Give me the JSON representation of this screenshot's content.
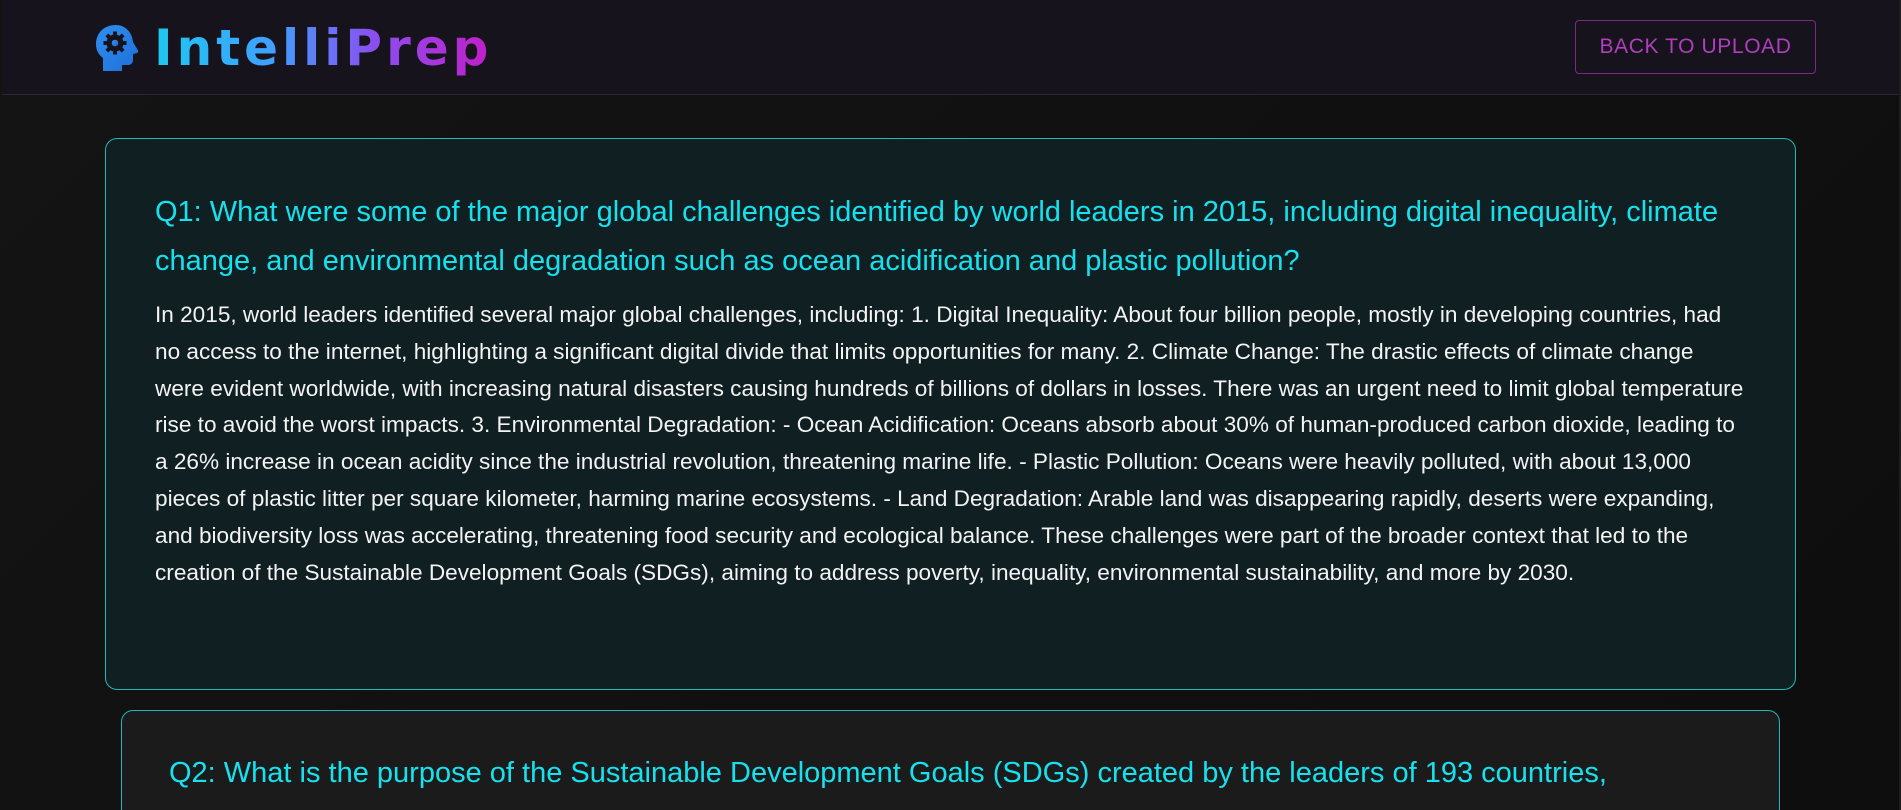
{
  "header": {
    "brand_name": "IntelliPrep",
    "brand_icon": "head-gear-icon",
    "back_button_label": "BACK TO UPLOAD"
  },
  "colors": {
    "accent_cyan": "#17e1ee",
    "accent_purple": "#b13dbf",
    "card_border": "#1fb8b8",
    "background": "#111112"
  },
  "questions": [
    {
      "title": "Q1: What were some of the major global challenges identified by world leaders in 2015, including digital inequality, climate change, and environmental degradation such as ocean acidification and plastic pollution?",
      "answer": "In 2015, world leaders identified several major global challenges, including: 1. Digital Inequality: About four billion people, mostly in developing countries, had no access to the internet, highlighting a significant digital divide that limits opportunities for many. 2. Climate Change: The drastic effects of climate change were evident worldwide, with increasing natural disasters causing hundreds of billions of dollars in losses. There was an urgent need to limit global temperature rise to avoid the worst impacts. 3. Environmental Degradation: - Ocean Acidification: Oceans absorb about 30% of human-produced carbon dioxide, leading to a 26% increase in ocean acidity since the industrial revolution, threatening marine life. - Plastic Pollution: Oceans were heavily polluted, with about 13,000 pieces of plastic litter per square kilometer, harming marine ecosystems. - Land Degradation: Arable land was disappearing rapidly, deserts were expanding, and biodiversity loss was accelerating, threatening food security and ecological balance. These challenges were part of the broader context that led to the creation of the Sustainable Development Goals (SDGs), aiming to address poverty, inequality, environmental sustainability, and more by 2030."
    },
    {
      "title": "Q2: What is the purpose of the Sustainable Development Goals (SDGs) created by the leaders of 193 countries,"
    }
  ]
}
